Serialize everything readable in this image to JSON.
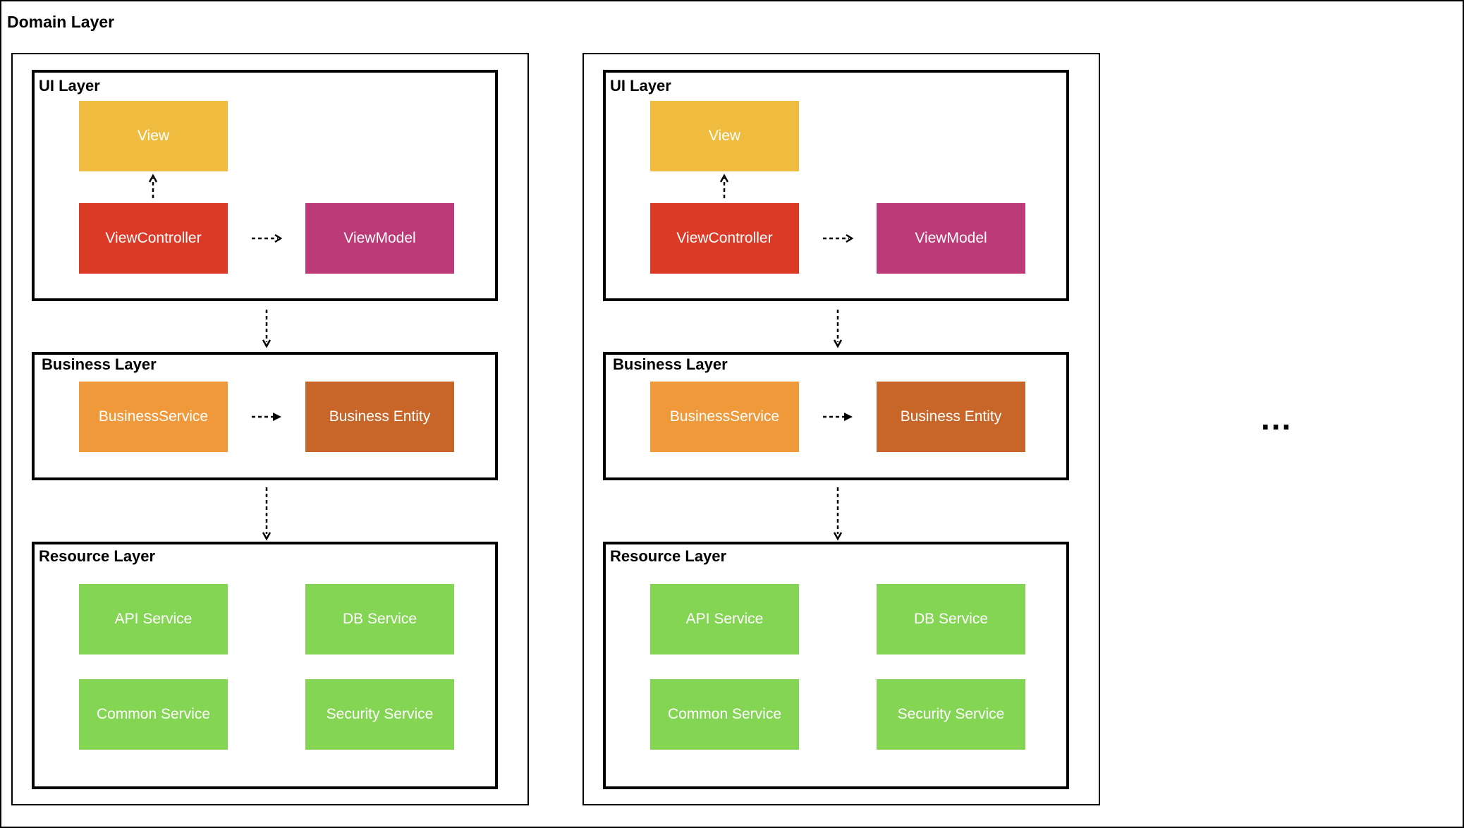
{
  "domain": {
    "title": "Domain Layer",
    "continuation": "..."
  },
  "colors": {
    "view": "#EFBC40",
    "view_controller": "#DB3B26",
    "view_model": "#BB3A77",
    "business_service": "#F0993A",
    "business_entity": "#C76628",
    "resource": "#84D554",
    "block_text": "#FFFFFF",
    "border": "#000000"
  },
  "columns": [
    {
      "ui_layer": {
        "title": "UI Layer",
        "view": "View",
        "view_controller": "ViewController",
        "view_model": "ViewModel"
      },
      "business_layer": {
        "title": "Business Layer",
        "service": "BusinessService",
        "entity": "Business Entity"
      },
      "resource_layer": {
        "title": "Resource Layer",
        "api": "API Service",
        "db": "DB Service",
        "common": "Common Service",
        "security": "Security Service"
      }
    },
    {
      "ui_layer": {
        "title": "UI Layer",
        "view": "View",
        "view_controller": "ViewController",
        "view_model": "ViewModel"
      },
      "business_layer": {
        "title": "Business Layer",
        "service": "BusinessService",
        "entity": "Business Entity"
      },
      "resource_layer": {
        "title": "Resource Layer",
        "api": "API Service",
        "db": "DB Service",
        "common": "Common Service",
        "security": "Security Service"
      }
    }
  ]
}
